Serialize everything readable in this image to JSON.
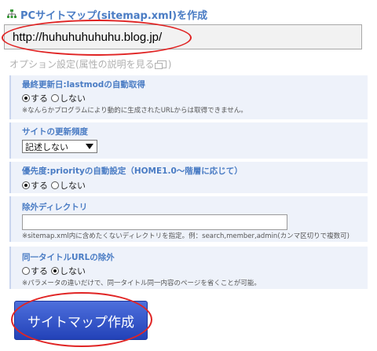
{
  "header": {
    "title": "PCサイトマップ(sitemap.xml)を作成",
    "icon": "sitemap-tree-icon"
  },
  "url_input": {
    "value": "http://huhuhuhuhuhu.blog.jp/"
  },
  "options_link": {
    "label": "オプション設定(属性の説明を見る",
    "suffix": ")",
    "icon": "popup-window-icon"
  },
  "options": {
    "lastmod": {
      "label": "最終更新日:lastmodの自動取得",
      "radio_yes": "する",
      "radio_no": "しない",
      "selected": "yes",
      "note": "※なんらかプログラムにより動的に生成されたURLからは取得できません。"
    },
    "changefreq": {
      "label": "サイトの更新頻度",
      "selected_value": "記述しない"
    },
    "priority": {
      "label": "優先度:priorityの自動設定（HOME1.0～階層に応じて）",
      "radio_yes": "する",
      "radio_no": "しない",
      "selected": "yes"
    },
    "exclude_dirs": {
      "label": "除外ディレクトリ",
      "value": "",
      "note": "※sitemap.xml内に含めたくないディレクトリを指定。例：search,member,admin(カンマ区切りで複数可)"
    },
    "same_title": {
      "label": "同一タイトルURLの除外",
      "radio_yes": "する",
      "radio_no": "しない",
      "selected": "no",
      "note": "※パラメータの違いだけで、同一タイトル同一内容のページを省くことが可能。"
    }
  },
  "submit_button": {
    "label": "サイトマップ作成"
  },
  "colors": {
    "accent_blue": "#4a7cc4",
    "button_blue": "#2f4fc8",
    "annotation_red": "#e02424",
    "section_bg": "#eef2fa"
  }
}
